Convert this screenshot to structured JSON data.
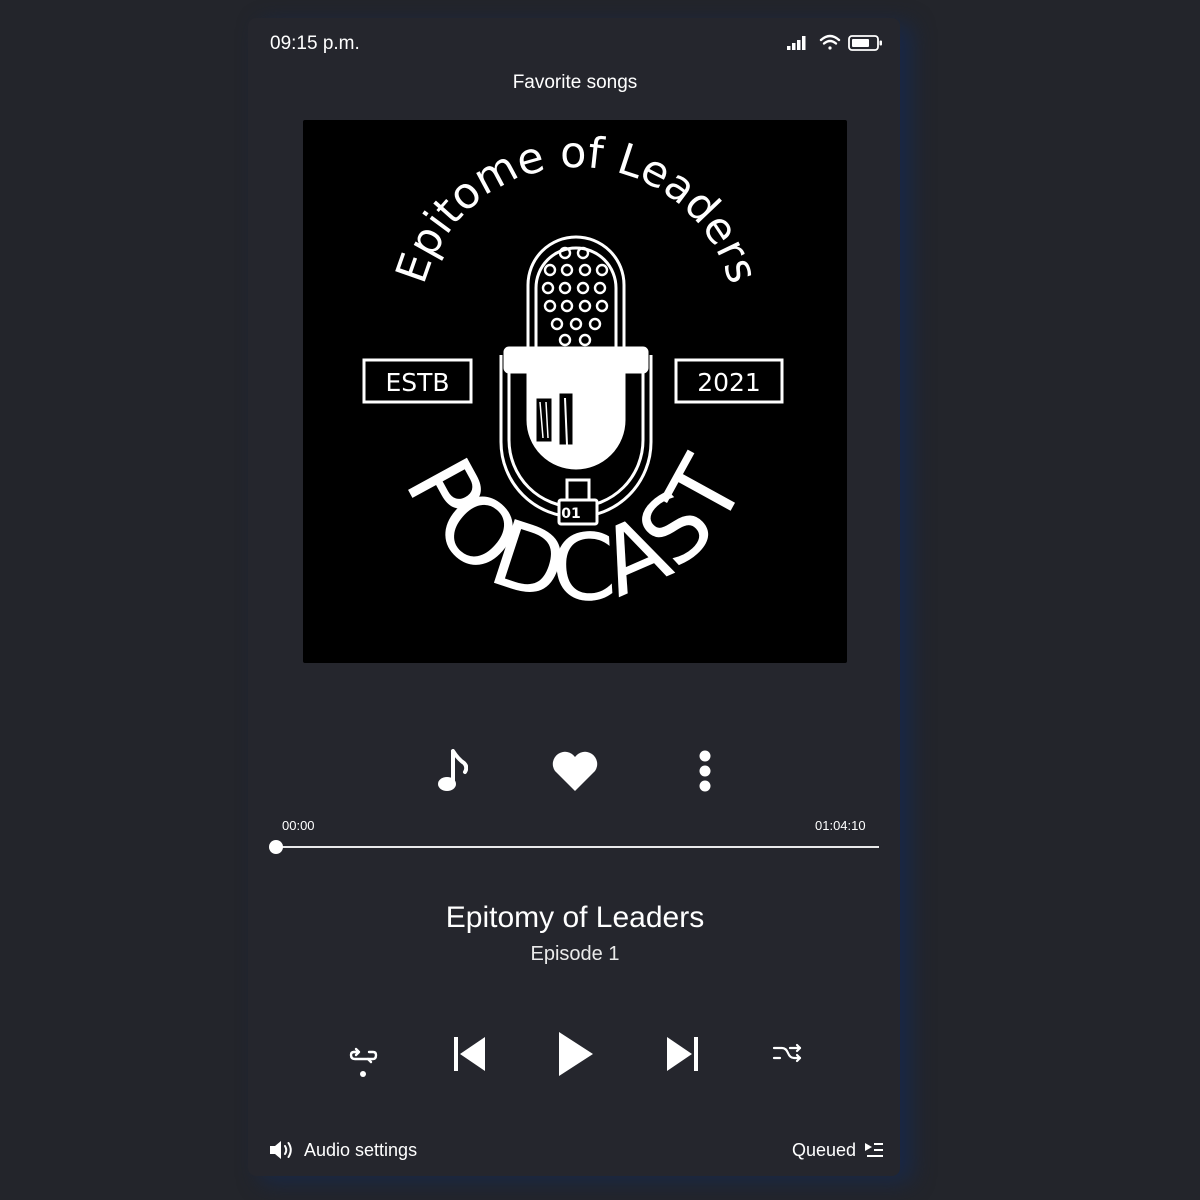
{
  "status_bar": {
    "time": "09:15 p.m.",
    "icons": [
      "signal-icon",
      "wifi-icon",
      "battery-icon"
    ]
  },
  "header": {
    "title": "Favorite songs"
  },
  "cover": {
    "arc_text": "Epitome of Leaders",
    "left_badge": "ESTB",
    "right_badge": "2021",
    "bottom_text": "PODCAST",
    "mic_badge": "01"
  },
  "actions": [
    "music-note-icon",
    "heart-icon",
    "more-vertical-icon"
  ],
  "player": {
    "elapsed": "00:00",
    "duration": "01:04:10",
    "progress": 0,
    "title": "Epitomy of Leaders",
    "subtitle": "Episode 1"
  },
  "controls": [
    "repeat-icon",
    "skip-previous-icon",
    "play-icon",
    "skip-next-icon",
    "shuffle-icon"
  ],
  "footer": {
    "audio_settings_label": "Audio settings",
    "queued_label": "Queued"
  },
  "colors": {
    "background": "#23252b",
    "panel": "#25262d",
    "foreground": "#ffffff",
    "art_background": "#000000"
  }
}
